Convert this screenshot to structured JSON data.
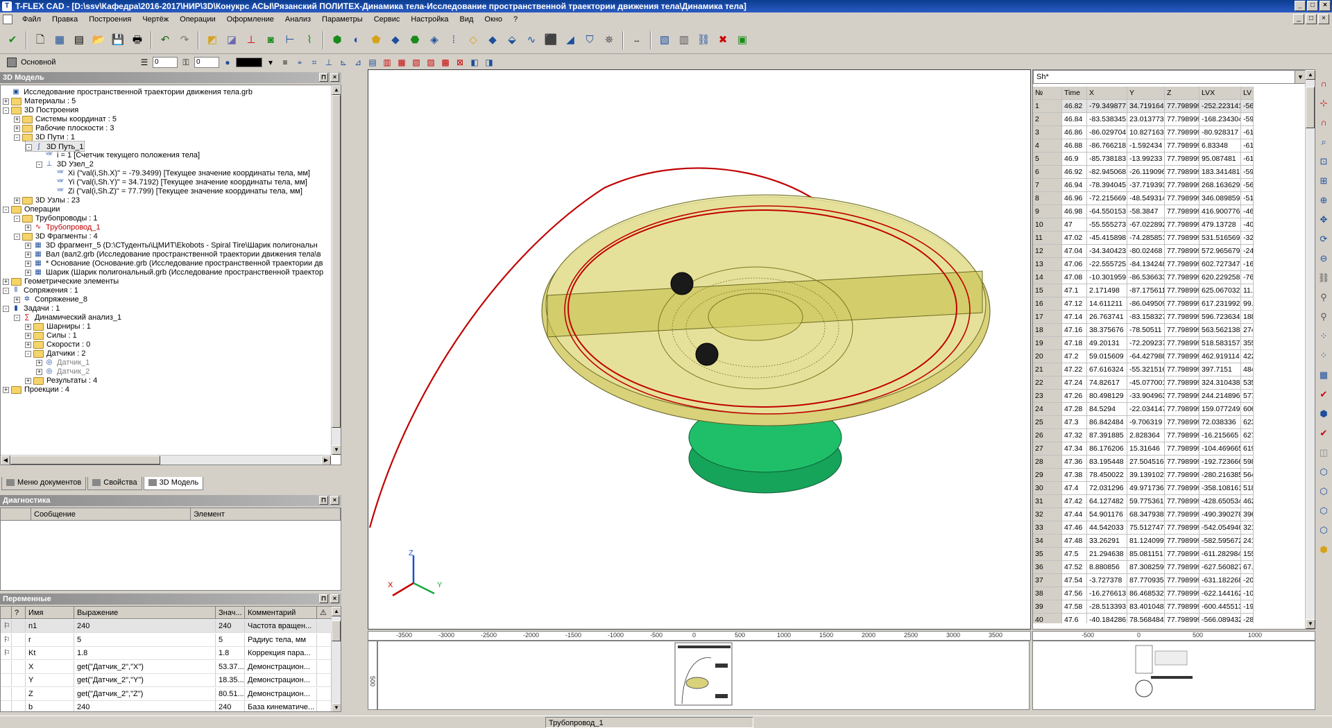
{
  "window": {
    "title": "T-FLEX CAD - [D:\\ssv\\Кафедра\\2016-2017\\НИР\\3D\\Конукрс АСЫ\\Рязанский ПОЛИТЕХ-Динамика тела-Исследование пространственной траектории движения тела\\Динамика тела]"
  },
  "menu": [
    "Файл",
    "Правка",
    "Построения",
    "Чертёж",
    "Операции",
    "Оформление",
    "Анализ",
    "Параметры",
    "Сервис",
    "Настройка",
    "Вид",
    "Окно",
    "?"
  ],
  "toolbar2": {
    "layer": "Основной",
    "spin1": "0",
    "spin2": "0"
  },
  "model_panel": {
    "title": "3D Модель",
    "tree": [
      {
        "level": 0,
        "exp": "",
        "icon": "file",
        "label": "Исследование пространственной траектории движения тела.grb"
      },
      {
        "level": 0,
        "exp": "+",
        "icon": "folder",
        "label": "Материалы : 5"
      },
      {
        "level": 0,
        "exp": "-",
        "icon": "folder",
        "label": "3D Построения"
      },
      {
        "level": 1,
        "exp": "+",
        "icon": "folder",
        "label": "Системы координат : 5"
      },
      {
        "level": 1,
        "exp": "+",
        "icon": "folder",
        "label": "Рабочие плоскости : 3"
      },
      {
        "level": 1,
        "exp": "-",
        "icon": "folder",
        "label": "3D Пути : 1"
      },
      {
        "level": 2,
        "exp": "-",
        "icon": "path",
        "label": "3D Путь_1",
        "selected": true
      },
      {
        "level": 3,
        "exp": "",
        "icon": "var",
        "label": "i = 1 [Счетчик текущего положения тела]"
      },
      {
        "level": 3,
        "exp": "-",
        "icon": "node",
        "label": "3D Узел_2"
      },
      {
        "level": 4,
        "exp": "",
        "icon": "var",
        "label": "Xi (\"val(i,Sh.X)\" = -79.3499) [Текущее значение координаты тела, мм]"
      },
      {
        "level": 4,
        "exp": "",
        "icon": "var",
        "label": "Yi (\"val(i,Sh.Y)\" = 34.7192) [Текущее значение координаты тела, мм]"
      },
      {
        "level": 4,
        "exp": "",
        "icon": "var",
        "label": "Zi (\"val(i,Sh.Z)\" = 77.799) [Текущее значение координаты тела, мм]"
      },
      {
        "level": 1,
        "exp": "+",
        "icon": "folder",
        "label": "3D Узлы : 23"
      },
      {
        "level": 0,
        "exp": "-",
        "icon": "folder",
        "label": "Операции"
      },
      {
        "level": 1,
        "exp": "-",
        "icon": "folder",
        "label": "Трубопроводы : 1"
      },
      {
        "level": 2,
        "exp": "+",
        "icon": "pipe",
        "label": "Трубопровод_1",
        "red": true
      },
      {
        "level": 1,
        "exp": "-",
        "icon": "folder",
        "label": "3D Фрагменты : 4"
      },
      {
        "level": 2,
        "exp": "+",
        "icon": "frag",
        "label": "3D фрагмент_5 (D:\\СТуденты\\ЦМИТ\\Ekobots - Spiral Tire\\Шарик полигональн"
      },
      {
        "level": 2,
        "exp": "+",
        "icon": "frag",
        "label": "Вал (вал2.grb (Исследование пространственной траектории движения тела\\в"
      },
      {
        "level": 2,
        "exp": "+",
        "icon": "frag",
        "label": "* Основание (Основание.grb (Исследование пространственной траектории дв"
      },
      {
        "level": 2,
        "exp": "+",
        "icon": "frag",
        "label": "Шарик (Шарик полигональный.grb (Исследование пространственной траектор"
      },
      {
        "level": 0,
        "exp": "+",
        "icon": "folder",
        "label": "Геометрические элементы"
      },
      {
        "level": 0,
        "exp": "-",
        "icon": "mate",
        "label": "Сопряжения : 1"
      },
      {
        "level": 1,
        "exp": "+",
        "icon": "mate2",
        "label": "Сопряжение_8"
      },
      {
        "level": 0,
        "exp": "-",
        "icon": "task",
        "label": "Задачи : 1"
      },
      {
        "level": 1,
        "exp": "-",
        "icon": "dyn",
        "label": "Динамический анализ_1"
      },
      {
        "level": 2,
        "exp": "+",
        "icon": "folder",
        "label": "Шарниры : 1"
      },
      {
        "level": 2,
        "exp": "+",
        "icon": "folder",
        "label": "Силы : 1"
      },
      {
        "level": 2,
        "exp": "+",
        "icon": "folder",
        "label": "Скорости : 0"
      },
      {
        "level": 2,
        "exp": "-",
        "icon": "folder",
        "label": "Датчики : 2"
      },
      {
        "level": 3,
        "exp": "+",
        "icon": "sensor",
        "label": "Датчик_1",
        "gray": true
      },
      {
        "level": 3,
        "exp": "+",
        "icon": "sensor",
        "label": "Датчик_2",
        "gray": true
      },
      {
        "level": 2,
        "exp": "+",
        "icon": "folder",
        "label": "Результаты : 4"
      },
      {
        "level": 0,
        "exp": "+",
        "icon": "folder",
        "label": "Проекции : 4"
      }
    ],
    "tabs": [
      "Меню документов",
      "Свойства",
      "3D Модель"
    ]
  },
  "diagnostics": {
    "title": "Диагностика",
    "columns": [
      "Сообщение",
      "Элемент"
    ]
  },
  "variables": {
    "title": "Переменные",
    "columns": [
      "?",
      "Имя",
      "Выражение",
      "Знач...",
      "Комментарий"
    ],
    "rows": [
      [
        "n1",
        "240",
        "240",
        "Частота вращен..."
      ],
      [
        "r",
        "5",
        "5",
        "Радиус тела, мм"
      ],
      [
        "Kt",
        "1.8",
        "1.8",
        "Коррекция пара..."
      ],
      [
        "X",
        "get(\"Датчик_2\",\"X\")",
        "53.37...",
        "Демонстрацион..."
      ],
      [
        "Y",
        "get(\"Датчик_2\",\"Y\")",
        "18.35...",
        "Демонстрацион..."
      ],
      [
        "Z",
        "get(\"Датчик_2\",\"Z\")",
        "80.51...",
        "Демонстрацион..."
      ],
      [
        "b",
        "240",
        "240",
        "База кинематиче..."
      ]
    ]
  },
  "viewport": {
    "ruler_labels": [
      "-3500",
      "-3000",
      "-2500",
      "-2000",
      "-1500",
      "-1000",
      "-500",
      "0",
      "500",
      "1000",
      "1500",
      "2000",
      "2500",
      "3000",
      "3500"
    ],
    "vruler_label": "500",
    "axes": {
      "x": "X",
      "y": "Y",
      "z": "Z"
    },
    "colors": {
      "trajectory": "#c00000",
      "disk": "#e8e58a",
      "base": "#1aa860"
    }
  },
  "spreadsheet": {
    "name": "Sh*",
    "columns": [
      "№",
      "Time",
      "X",
      "Y",
      "Z",
      "LVX",
      "LV"
    ],
    "rows": [
      [
        "1",
        "46.82",
        "-79.349877",
        "34.719164",
        "77.798999",
        "-252.223141",
        "-56"
      ],
      [
        "2",
        "46.84",
        "-83.538345",
        "23.013773",
        "77.798999",
        "-168.234304",
        "-59"
      ],
      [
        "3",
        "46.86",
        "-86.029704",
        "10.827163",
        "77.798999",
        "-80.928317",
        "-61"
      ],
      [
        "4",
        "46.88",
        "-86.766218",
        "-1.592434",
        "77.798999",
        "6.83348",
        "-61"
      ],
      [
        "5",
        "46.9",
        "-85.738183",
        "-13.99233",
        "77.798999",
        "95.087481",
        "-61"
      ],
      [
        "6",
        "46.92",
        "-82.945068",
        "-26.119096",
        "77.798999",
        "183.341481",
        "-59"
      ],
      [
        "7",
        "46.94",
        "-78.394045",
        "-37.719393",
        "77.798999",
        "268.163629",
        "-56"
      ],
      [
        "8",
        "46.96",
        "-72.215669",
        "-48.549314",
        "77.798999",
        "346.089859",
        "-51"
      ],
      [
        "9",
        "46.98",
        "-64.550153",
        "-58.3847",
        "77.798999",
        "416.900776",
        "-46"
      ],
      [
        "10",
        "47",
        "-55.555273",
        "-67.022892",
        "77.798999",
        "479.13728",
        "-40"
      ],
      [
        "11",
        "47.02",
        "-45.415898",
        "-74.285851",
        "77.798999",
        "531.516569",
        "-32"
      ],
      [
        "12",
        "47.04",
        "-34.340423",
        "-80.02468",
        "77.798999",
        "572.965679",
        "-24"
      ],
      [
        "13",
        "47.06",
        "-22.555725",
        "-84.134248",
        "77.798999",
        "602.727347",
        "-16"
      ],
      [
        "14",
        "47.08",
        "-10.301959",
        "-86.536633",
        "77.798999",
        "620.229258",
        "-76"
      ],
      [
        "15",
        "47.1",
        "2.171498",
        "-87.175611",
        "77.798999",
        "625.067032",
        "11."
      ],
      [
        "16",
        "47.12",
        "14.611211",
        "-86.049509",
        "77.798999",
        "617.231992",
        "99."
      ],
      [
        "17",
        "47.14",
        "26.763741",
        "-83.158327",
        "77.798999",
        "596.723634",
        "188"
      ],
      [
        "18",
        "47.16",
        "38.375676",
        "-78.50511",
        "77.798999",
        "563.562138",
        "274"
      ],
      [
        "19",
        "47.18",
        "49.20131",
        "-72.209237",
        "77.798999",
        "518.583157",
        "355"
      ],
      [
        "20",
        "47.2",
        "59.015609",
        "-64.427988",
        "77.798999",
        "462.919114",
        "422"
      ],
      [
        "21",
        "47.22",
        "67.616324",
        "-55.321516",
        "77.798999",
        "397.7151",
        "484"
      ],
      [
        "22",
        "47.24",
        "74.82617",
        "-45.077001",
        "77.798999",
        "324.310438",
        "535"
      ],
      [
        "23",
        "47.26",
        "80.498129",
        "-33.904963",
        "77.798999",
        "244.214896",
        "577"
      ],
      [
        "24",
        "47.28",
        "84.5294",
        "-22.034147",
        "77.798999",
        "159.077249",
        "606"
      ],
      [
        "25",
        "47.3",
        "86.842484",
        "-9.706319",
        "77.798999",
        "72.038336",
        "623"
      ],
      [
        "26",
        "47.32",
        "87.391885",
        "2.828364",
        "77.798999",
        "-16.215665",
        "627"
      ],
      [
        "27",
        "47.34",
        "86.176206",
        "15.31646",
        "77.798999",
        "-104.469665",
        "619"
      ],
      [
        "28",
        "47.36",
        "83.195448",
        "27.504516",
        "77.798999",
        "-192.723666",
        "598"
      ],
      [
        "29",
        "47.38",
        "78.450022",
        "39.139102",
        "77.798999",
        "-280.216385",
        "564"
      ],
      [
        "30",
        "47.4",
        "72.031296",
        "49.971736",
        "77.798999",
        "-358.108161",
        "518"
      ],
      [
        "31",
        "47.42",
        "64.127482",
        "59.775361",
        "77.798999",
        "-428.650534",
        "462"
      ],
      [
        "32",
        "47.44",
        "54.901176",
        "68.347938",
        "77.798999",
        "-490.390278",
        "396"
      ],
      [
        "33",
        "47.46",
        "44.542033",
        "75.512747",
        "77.798999",
        "-542.054946",
        "321"
      ],
      [
        "34",
        "47.48",
        "33.26291",
        "81.124099",
        "77.798999",
        "-582.595672",
        "241"
      ],
      [
        "35",
        "47.5",
        "21.294638",
        "85.081151",
        "77.798999",
        "-611.282984",
        "155"
      ],
      [
        "36",
        "47.52",
        "8.880856",
        "87.308259",
        "77.798999",
        "-627.560827",
        "67."
      ],
      [
        "37",
        "47.54",
        "-3.727378",
        "87.770935",
        "77.798999",
        "-631.182268",
        "-20"
      ],
      [
        "38",
        "47.56",
        "-16.276613",
        "86.468532",
        "77.798999",
        "-622.144162",
        "-10"
      ],
      [
        "39",
        "47.58",
        "-28.513393",
        "83.401048",
        "77.798999",
        "-600.445513",
        "-19"
      ],
      [
        "40",
        "47.6",
        "-40.184286",
        "78.568484",
        "77.798999",
        "-566.089432",
        "-28"
      ]
    ],
    "ruler_labels": [
      "-500",
      "0",
      "500",
      "1000"
    ]
  },
  "status": {
    "text": "Трубопровод_1"
  }
}
